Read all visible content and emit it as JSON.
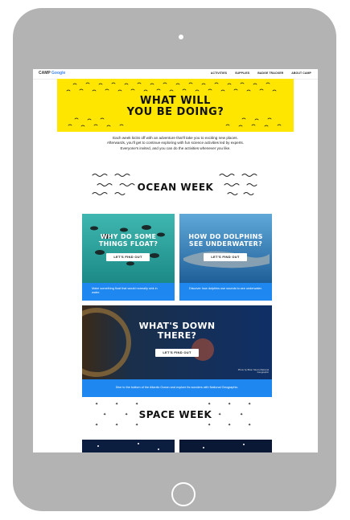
{
  "nav": {
    "logo_camp": "CAMP",
    "logo_brand": "Google",
    "links": [
      "ACTIVITIES",
      "SUPPLIES",
      "BADGE TRACKER",
      "ABOUT CAMP"
    ]
  },
  "hero": {
    "title_line1": "WHAT WILL",
    "title_line2": "YOU BE DOING?",
    "intro": "Each week kicks off with an adventure that'll take you to exciting new places. Afterwards, you'll get to continue exploring with fun science activities led by experts. Everyone's invited, and you can do the activities whenever you like."
  },
  "ocean": {
    "title": "OCEAN WEEK",
    "cards": [
      {
        "title_line1": "WHY DO SOME",
        "title_line2": "THINGS FLOAT?",
        "button": "LET'S FIND OUT",
        "caption": "Make something float that would normally sink in water."
      },
      {
        "title_line1": "HOW DO DOLPHINS",
        "title_line2": "SEE UNDERWATER?",
        "button": "LET'S FIND OUT",
        "caption": "Discover how dolphins use sounds to see underwater."
      },
      {
        "title_line1": "WHAT'S DOWN",
        "title_line2": "THERE?",
        "button": "LET'S FIND OUT",
        "caption": "Dive to the bottom of the Atlantic Ocean and explore its wonders with National Geographic.",
        "credit": "Photo by Brian Skerry/National Geographic"
      }
    ]
  },
  "space": {
    "title": "SPACE WEEK"
  },
  "colors": {
    "hero_yellow": "#ffe600",
    "caption_blue": "#1f88f0",
    "tablet_gray": "#b3b3b3"
  }
}
